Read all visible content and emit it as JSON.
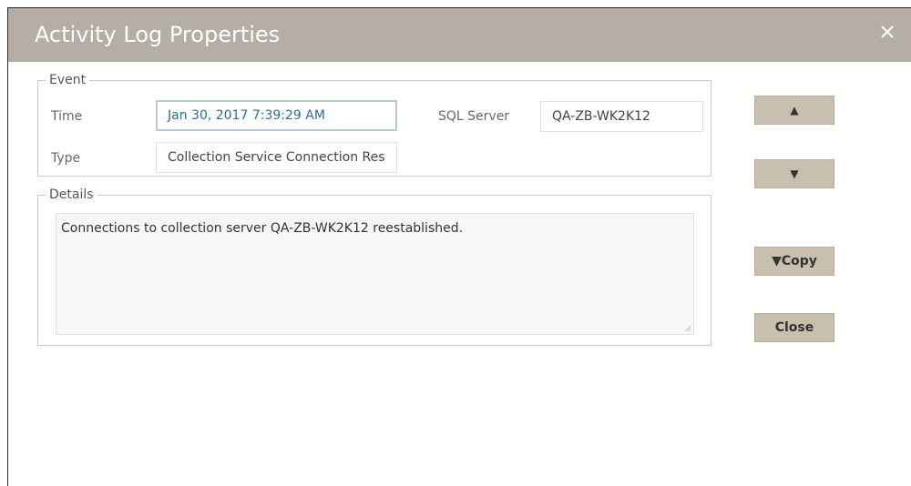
{
  "dialog": {
    "title": "Activity Log Properties",
    "close_icon": "close-icon"
  },
  "event": {
    "legend": "Event",
    "time_label": "Time",
    "time_value": "Jan 30, 2017 7:39:29 AM",
    "type_label": "Type",
    "type_value": "Collection Service Connection Res",
    "sql_server_label": "SQL Server",
    "sql_server_value": "QA-ZB-WK2K12"
  },
  "details": {
    "legend": "Details",
    "text": "Connections to collection server QA-ZB-WK2K12 reestablished."
  },
  "buttons": {
    "up_glyph": "▲",
    "down_glyph": "▼",
    "copy_label": "▼Copy",
    "close_label": "Close"
  },
  "colors": {
    "titlebar": "#b5aea4",
    "button": "#c8bfae",
    "focused_text": "#2c6f94"
  }
}
